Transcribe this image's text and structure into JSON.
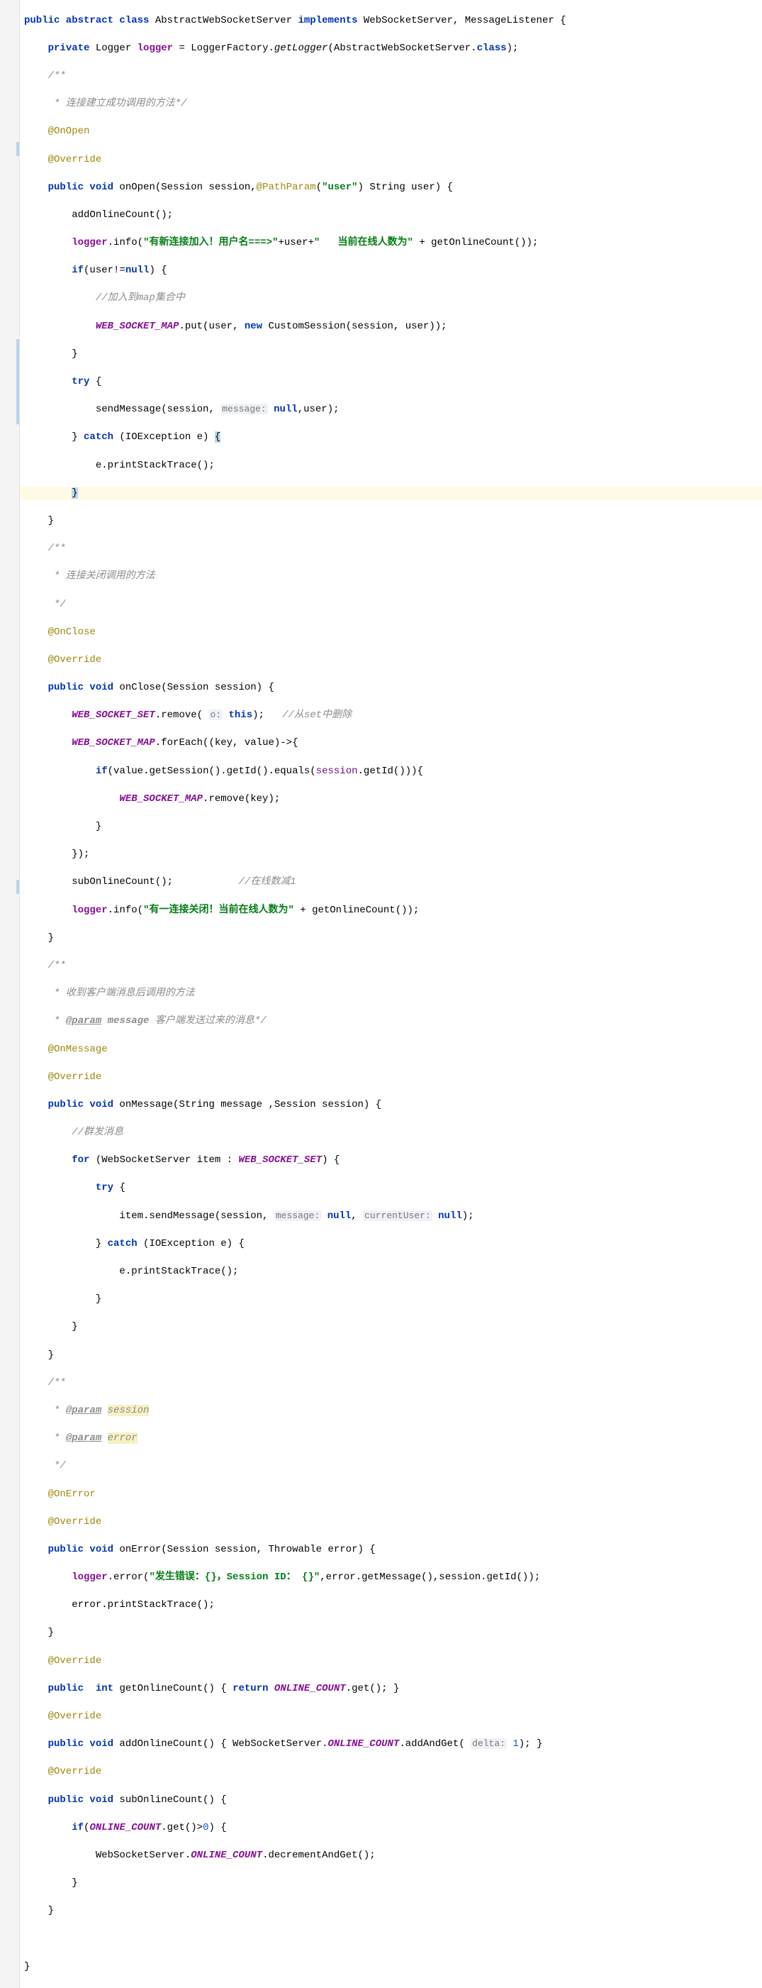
{
  "code": {
    "l1": [
      "public abstract class",
      " AbstractWebSocketServer ",
      "implements",
      " WebSocketServer, MessageListener {"
    ],
    "l2": [
      "    ",
      "private",
      " Logger ",
      "logger",
      " = LoggerFactory.",
      "getLogger",
      "(AbstractWebSocketServer.",
      "class",
      ");"
    ],
    "l3": "    /**",
    "l4": "     * 连接建立成功调用的方法*/",
    "l5": "    @OnOpen",
    "l6": "    @Override",
    "l7": [
      "    ",
      "public void",
      " onOpen(Session session,",
      "@PathParam",
      "(",
      "\"user\"",
      ") String user) {"
    ],
    "l8": "        addOnlineCount();",
    "l9a": "        ",
    "l9b": "logger",
    "l9c": ".info(",
    "l9d": "\"有新连接加入！用户名===>\"",
    "l9e": "+user+",
    "l9f": "\"   当前在线人数为\"",
    "l9g": " + getOnlineCount());",
    "l10": [
      "        ",
      "if",
      "(user!=",
      "null",
      ") {"
    ],
    "l11": "            //加入到map集合中",
    "l12": [
      "            ",
      "WEB_SOCKET_MAP",
      ".put(user, ",
      "new",
      " CustomSession(session, user));"
    ],
    "l13": "        }",
    "l14": [
      "        ",
      "try",
      " {"
    ],
    "l15": [
      "            sendMessage(session, ",
      "message:",
      " ",
      "null",
      ",user);"
    ],
    "l16": [
      "        } ",
      "catch",
      " (IOException e) ",
      "{"
    ],
    "l17": "            e.printStackTrace();",
    "l18": "        }",
    "l19": "    }",
    "l20": "    /**",
    "l21": "     * 连接关闭调用的方法",
    "l22": "     */",
    "l23": "    @OnClose",
    "l24": "    @Override",
    "l25": [
      "    ",
      "public void",
      " onClose(Session session) {"
    ],
    "l26": [
      "        ",
      "WEB_SOCKET_SET",
      ".remove( ",
      "o:",
      " ",
      "this",
      ");   ",
      "//从set中删除"
    ],
    "l27": [
      "        ",
      "WEB_SOCKET_MAP",
      ".forEach((key, value)->{"
    ],
    "l28": [
      "            ",
      "if",
      "(value.getSession().getId().equals(",
      "session",
      ".getId())){"
    ],
    "l29": [
      "                ",
      "WEB_SOCKET_MAP",
      ".remove(key);"
    ],
    "l30": "            }",
    "l31": "        });",
    "l32": [
      "        subOnlineCount();           ",
      "//在线数减1"
    ],
    "l33": [
      "        ",
      "logger",
      ".info(",
      "\"有一连接关闭！当前在线人数为\"",
      " + getOnlineCount());"
    ],
    "l34": "    }",
    "l35": "    /**",
    "l36": "     * 收到客户端消息后调用的方法",
    "l37a": "     * ",
    "l37b": "@param",
    "l37c": " ",
    "l37d": "message",
    "l37e": " 客户端发送过来的消息*/",
    "l38": "    @OnMessage",
    "l39": "    @Override",
    "l40": [
      "    ",
      "public void",
      " onMessage(String message ,Session session) {"
    ],
    "l41": "        //群发消息",
    "l42": [
      "        ",
      "for",
      " (WebSocketServer item : ",
      "WEB_SOCKET_SET",
      ") {"
    ],
    "l43": [
      "            ",
      "try",
      " {"
    ],
    "l44": [
      "                item.sendMessage(session, ",
      "message:",
      " ",
      "null",
      ", ",
      "currentUser:",
      " ",
      "null",
      ");"
    ],
    "l45": [
      "            } ",
      "catch",
      " (IOException e) {"
    ],
    "l46": "                e.printStackTrace();",
    "l47": "            }",
    "l48": "        }",
    "l49": "    }",
    "l50": "    /**",
    "l51a": "     * ",
    "l51b": "@param",
    "l51c": " ",
    "l51d": "session",
    "l52a": "     * ",
    "l52b": "@param",
    "l52c": " ",
    "l52d": "error",
    "l53": "     */",
    "l54": "    @OnError",
    "l55": "    @Override",
    "l56": [
      "    ",
      "public void",
      " onError(Session session, Throwable error) {"
    ],
    "l57": [
      "        ",
      "logger",
      ".error(",
      "\"发生错误：{}，Session ID： {}\"",
      ",error.getMessage(),session.getId());"
    ],
    "l58": "        error.printStackTrace();",
    "l59": "    }",
    "l60": "    @Override",
    "l61": [
      "    ",
      "public",
      "  ",
      "int",
      " getOnlineCount() { ",
      "return",
      " ",
      "ONLINE_COUNT",
      ".get(); }"
    ],
    "l62": "    @Override",
    "l63": [
      "    ",
      "public void",
      " addOnlineCount() { WebSocketServer.",
      "ONLINE_COUNT",
      ".addAndGet( ",
      "delta:",
      " ",
      "1",
      "); }"
    ],
    "l64": "    @Override",
    "l65": [
      "    ",
      "public void",
      " subOnlineCount() {"
    ],
    "l66": [
      "        ",
      "if",
      "(",
      "ONLINE_COUNT",
      ".get()>",
      "0",
      ") {"
    ],
    "l67": [
      "            WebSocketServer.",
      "ONLINE_COUNT",
      ".decrementAndGet();"
    ],
    "l68": "        }",
    "l69": "    }",
    "l70": "",
    "l71": "}"
  }
}
